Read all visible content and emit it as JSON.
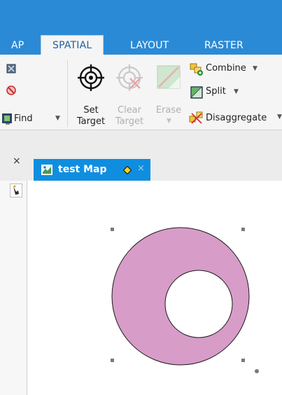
{
  "ribbon": {
    "tabs": [
      {
        "label": "AP"
      },
      {
        "label": "SPATIAL",
        "active": true
      },
      {
        "label": "LAYOUT"
      },
      {
        "label": "RASTER"
      }
    ],
    "find_label": "Find",
    "set_target_line1": "Set",
    "set_target_line2": "Target",
    "clear_target_line1": "Clear",
    "clear_target_line2": "Target",
    "erase_label": "Erase",
    "combine_label": "Combine",
    "split_label": "Split",
    "disaggregate_label": "Disaggregate"
  },
  "document": {
    "tab_title": "test Map",
    "close_glyph": "×"
  },
  "panel": {
    "close_glyph": "×"
  },
  "map": {
    "outer_fill": "#d79cc8",
    "inner_fill": "#ffffff"
  },
  "colors": {
    "accent": "#2b8ad6",
    "doc_tab": "#0f8ee0"
  }
}
